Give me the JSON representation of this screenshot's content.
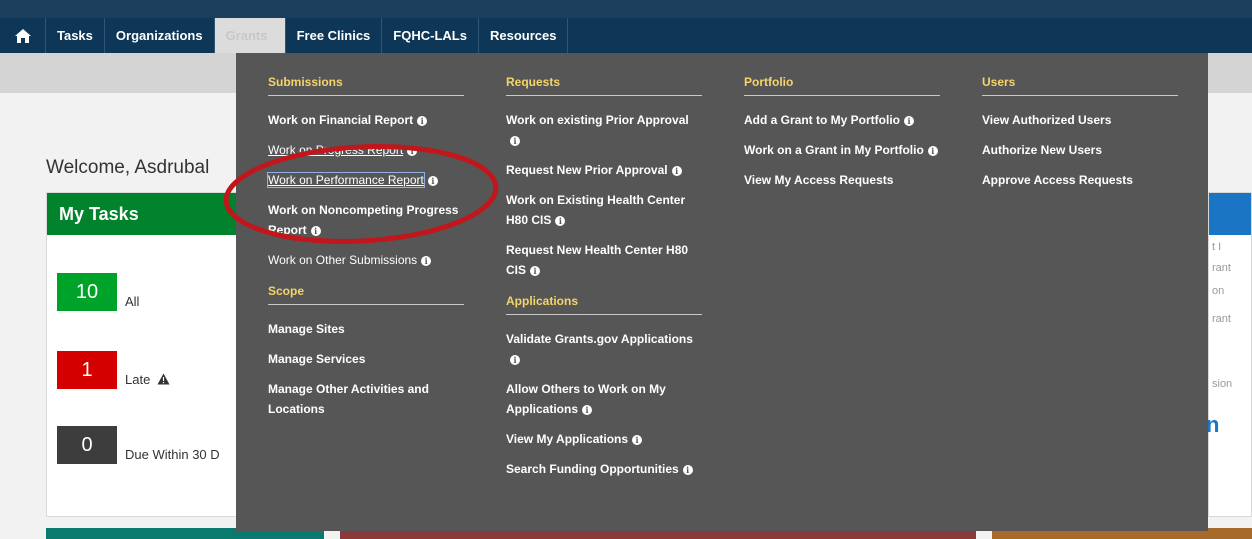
{
  "nav": {
    "items": [
      {
        "label": "Tasks"
      },
      {
        "label": "Organizations"
      },
      {
        "label": "Grants"
      },
      {
        "label": "Free Clinics"
      },
      {
        "label": "FQHC-LALs"
      },
      {
        "label": "Resources"
      }
    ],
    "home_icon": "home-icon"
  },
  "welcome": "Welcome, Asdrubal",
  "tasks": {
    "title": "My Tasks",
    "rows": [
      {
        "count": "10",
        "label": "All",
        "color": "#00a32a"
      },
      {
        "count": "1",
        "label": "Late",
        "color": "#d40000"
      },
      {
        "count": "0",
        "label": "Due Within 30 D",
        "color": "#3d3d3d"
      }
    ]
  },
  "right_panel": {
    "fragments": [
      "t I",
      "rant",
      "on",
      "rant",
      "sion"
    ],
    "big": "n"
  },
  "menu": {
    "submissions": {
      "heading": "Submissions",
      "links": [
        "Work on Financial Report",
        "Work on Progress Report",
        "Work on Performance Report",
        "Work on Noncompeting Progress Report",
        "Work on Other Submissions"
      ]
    },
    "scope": {
      "heading": "Scope",
      "links": [
        "Manage Sites",
        "Manage Services",
        "Manage Other Activities and Locations"
      ]
    },
    "requests": {
      "heading": "Requests",
      "links": [
        "Work on existing Prior Approval",
        "Request New Prior Approval",
        "Work on Existing Health Center H80 CIS",
        "Request New Health Center H80 CIS"
      ]
    },
    "applications": {
      "heading": "Applications",
      "links": [
        "Validate Grants.gov Applications",
        "Allow Others to Work on My Applications",
        "View My Applications",
        "Search Funding Opportunities"
      ]
    },
    "portfolio": {
      "heading": "Portfolio",
      "links": [
        "Add a Grant to My Portfolio",
        "Work on a Grant in My Portfolio",
        "View My Access Requests"
      ]
    },
    "users": {
      "heading": "Users",
      "links": [
        "View Authorized Users",
        "Authorize New Users",
        "Approve Access Requests"
      ]
    }
  },
  "colors": {
    "nav_bg": "#0e3757",
    "menu_bg": "#565656",
    "heading_yellow": "#f4d46b",
    "highlight_ellipse": "#c0161c"
  }
}
